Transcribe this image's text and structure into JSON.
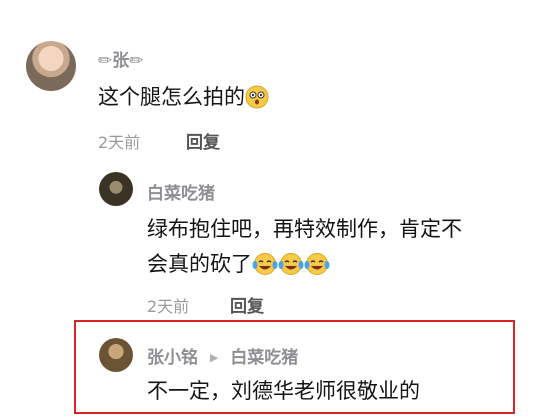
{
  "comments": [
    {
      "user": "✏张✏",
      "text": "这个腿怎么拍的",
      "emoji": "astonished-face",
      "time": "2天前",
      "reply_label": "回复"
    },
    {
      "user": "白菜吃猪",
      "text_line1": "绿布抱住吧，再特效制作，肯定不",
      "text_line2": "会真的砍了",
      "emojis": [
        "tears-of-joy-face",
        "tears-of-joy-face",
        "tears-of-joy-face"
      ],
      "time": "2天前",
      "reply_label": "回复"
    },
    {
      "user": "张小铭",
      "reply_arrow": "▶",
      "reply_to": "白菜吃猪",
      "text": "不一定，刘德华老师很敬业的"
    }
  ],
  "colors": {
    "highlight": "#d9232a",
    "name": "#8e8e93",
    "text": "#141414",
    "meta": "#9a9a9a"
  }
}
